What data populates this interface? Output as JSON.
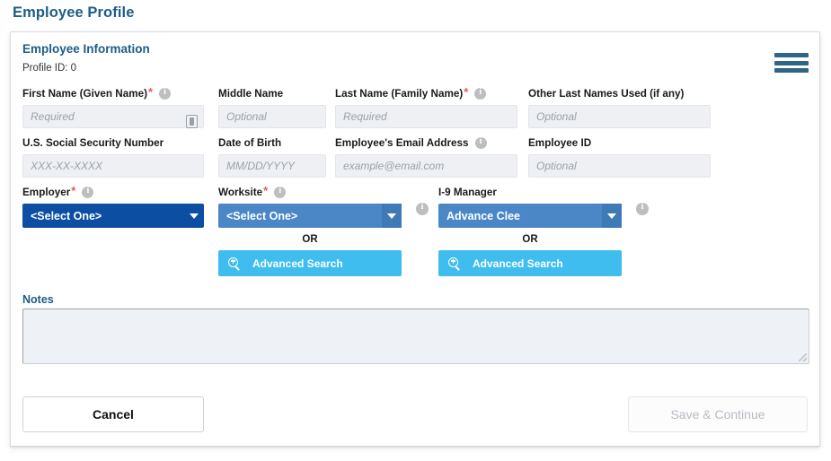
{
  "page": {
    "title": "Employee Profile"
  },
  "card": {
    "title": "Employee Information",
    "profile_id": "Profile ID: 0",
    "menu_icon": "hamburger-menu-icon"
  },
  "fields": {
    "first_name": {
      "label": "First Name (Given Name)",
      "required": true,
      "placeholder": "Required",
      "value": "",
      "info": true,
      "inline_icon": "id-card-icon"
    },
    "middle_name": {
      "label": "Middle Name",
      "required": false,
      "placeholder": "Optional",
      "value": "",
      "info": false
    },
    "last_name": {
      "label": "Last Name (Family Name)",
      "required": true,
      "placeholder": "Required",
      "value": "",
      "info": true
    },
    "other_names": {
      "label": "Other Last Names Used (if any)",
      "required": false,
      "placeholder": "Optional",
      "value": "",
      "info": false
    },
    "ssn": {
      "label": "U.S. Social Security Number",
      "required": false,
      "placeholder": "XXX-XX-XXXX",
      "value": "",
      "info": false
    },
    "dob": {
      "label": "Date of Birth",
      "required": false,
      "placeholder": "MM/DD/YYYY",
      "value": "",
      "info": false
    },
    "email": {
      "label": "Employee's Email Address",
      "required": false,
      "placeholder": "example@email.com",
      "value": "",
      "info": true
    },
    "employee_id": {
      "label": "Employee ID",
      "required": false,
      "placeholder": "Optional",
      "value": "",
      "info": false
    }
  },
  "selectors": {
    "employer": {
      "label": "Employer",
      "required": true,
      "info": true,
      "value": "<Select One>",
      "style": "dark"
    },
    "worksite": {
      "label": "Worksite",
      "required": true,
      "info": true,
      "trailing_info": true,
      "value": "<Select One>",
      "style": "light",
      "or_label": "OR",
      "advanced_search": "Advanced Search"
    },
    "i9_manager": {
      "label": "I-9 Manager",
      "required": false,
      "info": false,
      "trailing_info": true,
      "value": "Advance Clee",
      "style": "light",
      "or_label": "OR",
      "advanced_search": "Advanced Search"
    }
  },
  "notes": {
    "label": "Notes",
    "value": "",
    "placeholder": ""
  },
  "footer": {
    "cancel_label": "Cancel",
    "save_label": "Save & Continue",
    "save_disabled": true
  },
  "colors": {
    "title_blue": "#1d5c86",
    "select_dark_blue": "#0b4ea2",
    "select_light_blue": "#4b87c6",
    "advanced_search_cyan": "#3fbdee",
    "required_star_red": "#e05c5c",
    "input_bg": "#eef0f3",
    "menu_icon": "#2f6587"
  }
}
